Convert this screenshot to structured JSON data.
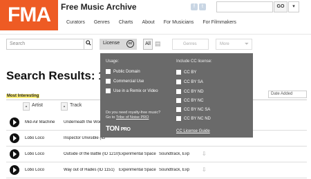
{
  "header": {
    "logo": "FMA",
    "site_title": "Free Music Archive",
    "social": [
      "f",
      "t"
    ],
    "search_placeholder": "",
    "go_label": "GO",
    "menu_chevron": "▾"
  },
  "nav": [
    "Curators",
    "Genres",
    "Charts",
    "About",
    "For Musicians",
    "For Filmmakers"
  ],
  "filters": {
    "search_placeholder": "Search",
    "search_icon": "magnifier",
    "license_label": "License",
    "cc_badge": "cc",
    "all_label": "All",
    "genres_placeholder": "Genres",
    "more_placeholder": "More"
  },
  "results": {
    "title": "Search Results: 17",
    "sort_tab": "Most Interesting",
    "sort_select": "Date Added"
  },
  "table": {
    "columns": [
      "Artist",
      "Track"
    ],
    "rows": [
      {
        "artist": "Mid-Air Machine",
        "track": "Underneath the World",
        "album": "",
        "genre": ""
      },
      {
        "artist": "Lobo Loco",
        "track": "Inspector Unvisible (ID",
        "album": "",
        "genre": ""
      },
      {
        "artist": "Lobo Loco",
        "track": "Outside of the Battle (ID 1210)",
        "album": "Experimental Space",
        "genre": "Soundtrack, Exp"
      },
      {
        "artist": "Lobo Loco",
        "track": "Way out of Hades (ID 1151)",
        "album": "Experimental Space",
        "genre": "Soundtrack, Exp"
      }
    ]
  },
  "license_dropdown": {
    "usage_heading": "Usage:",
    "usage_options": [
      "Public Domain",
      "Commercial Use",
      "Use in a Remix or Video"
    ],
    "cc_heading": "Include CC license:",
    "cc_options": [
      "CC BY",
      "CC BY SA",
      "CC BY ND",
      "CC BY NC",
      "CC BY NC SA",
      "CC BY NC ND"
    ],
    "promo_line1": "Do you need royalty-free music?",
    "promo_line2_prefix": "Go to ",
    "promo_link": "Tribe of Noise PRO",
    "ton_logo": "TON",
    "ton_logo_suffix": "PRO",
    "guide_link": "CC License Guide"
  },
  "colors": {
    "brand": "#ee5b24",
    "dropdown_bg": "#6a6a6a",
    "highlight": "#fff07a"
  }
}
